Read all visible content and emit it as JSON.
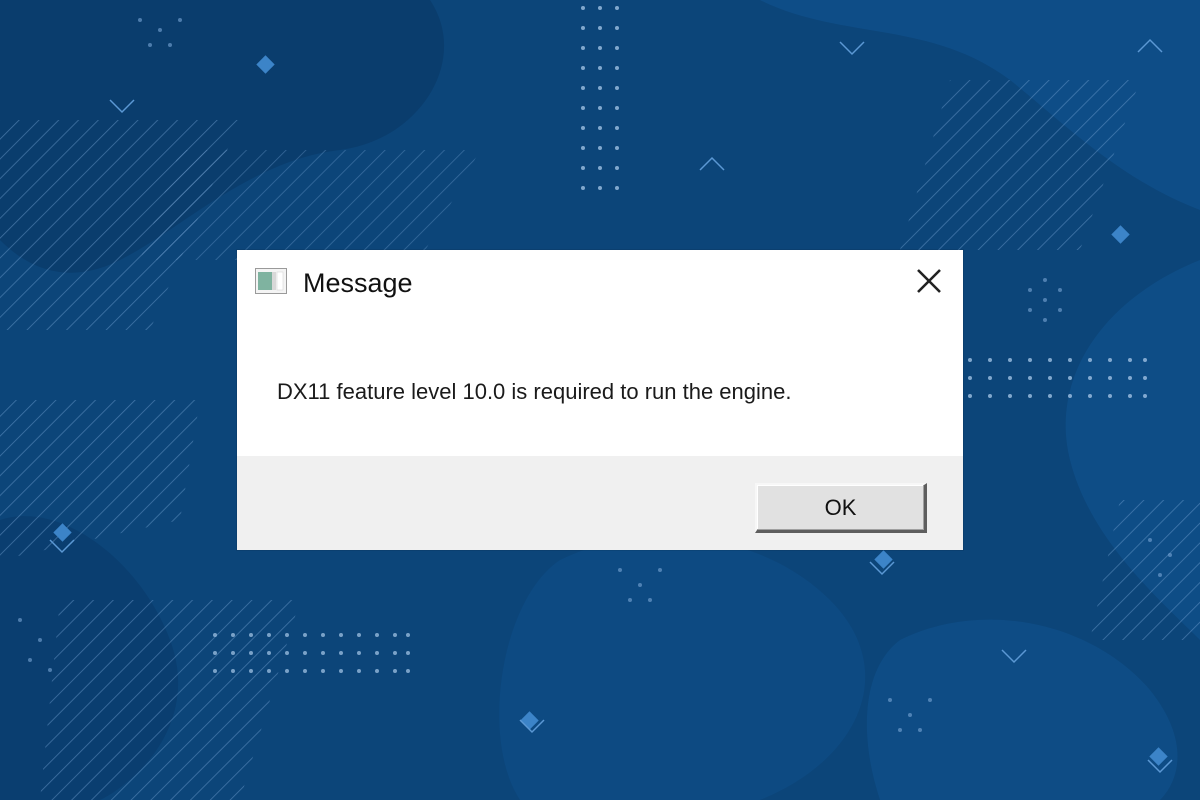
{
  "dialog": {
    "title": "Message",
    "message": "DX11 feature level 10.0 is required to run the engine.",
    "ok_label": "OK"
  },
  "icons": {
    "app": "application-window-icon",
    "close": "close-icon"
  },
  "colors": {
    "background": "#0c4579",
    "dialog_body": "#ffffff",
    "dialog_footer": "#f0f0f0"
  }
}
